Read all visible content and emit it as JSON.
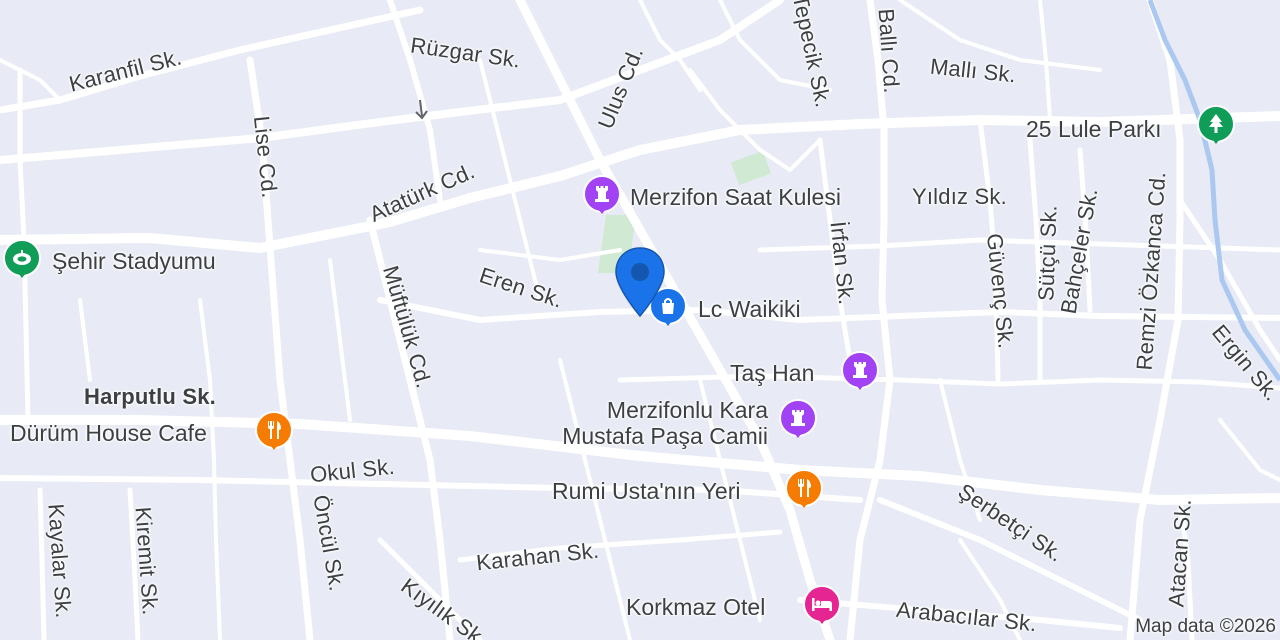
{
  "map": {
    "attribution": "Map data ©2026",
    "streets": [
      {
        "id": "karanfil",
        "label": "Karanfil Sk."
      },
      {
        "id": "ruzgar",
        "label": "Rüzgar Sk."
      },
      {
        "id": "ulus",
        "label": "Ulus Cd."
      },
      {
        "id": "tepecik",
        "label": "Tepecik Sk."
      },
      {
        "id": "bali",
        "label": "Ballı Cd."
      },
      {
        "id": "malli",
        "label": "Mallı Sk."
      },
      {
        "id": "lise",
        "label": "Lise Cd."
      },
      {
        "id": "ataturk",
        "label": "Atatürk Cd."
      },
      {
        "id": "yildiz",
        "label": "Yıldız Sk."
      },
      {
        "id": "irfan",
        "label": "İrfan Sk."
      },
      {
        "id": "guvenc",
        "label": "Güvenç Sk."
      },
      {
        "id": "sutcu",
        "label": "Sütçü Sk."
      },
      {
        "id": "bahceler",
        "label": "Bahçeler Sk."
      },
      {
        "id": "remzi",
        "label": "Remzi Özkanca Cd."
      },
      {
        "id": "ergin",
        "label": "Ergin Sk."
      },
      {
        "id": "eren",
        "label": "Eren Sk."
      },
      {
        "id": "muftuluk",
        "label": "Müftülük Cd."
      },
      {
        "id": "harputlu",
        "label": "Harputlu Sk."
      },
      {
        "id": "okul",
        "label": "Okul Sk."
      },
      {
        "id": "oncul",
        "label": "Öncül Sk."
      },
      {
        "id": "serbetci",
        "label": "Şerbetçi Sk."
      },
      {
        "id": "atacan",
        "label": "Atacan Sk."
      },
      {
        "id": "karahan",
        "label": "Karahan Sk."
      },
      {
        "id": "kiyilik",
        "label": "Kıyılık Sk."
      },
      {
        "id": "arabacilar",
        "label": "Arabacılar Sk."
      },
      {
        "id": "kayalar",
        "label": "Kayalar Sk."
      },
      {
        "id": "kiremit",
        "label": "Kiremit Sk."
      }
    ],
    "pois": [
      {
        "id": "lule-parki",
        "label": "25 Lule Parkı",
        "icon": "tree-icon",
        "color": "#0f9d58"
      },
      {
        "id": "saat-kulesi",
        "label": "Merzifon Saat Kulesi",
        "icon": "landmark-icon",
        "color": "#a142f4"
      },
      {
        "id": "stadyum",
        "label": "Şehir Stadyumu",
        "icon": "stadium-icon",
        "color": "#0f9d58"
      },
      {
        "id": "lc-waikiki",
        "label": "Lc Waikiki",
        "icon": "shopping-bag-icon",
        "color": "#1a73e8"
      },
      {
        "id": "tas-han",
        "label": "Taş Han",
        "icon": "landmark-icon",
        "color": "#a142f4"
      },
      {
        "id": "kara-mustafa",
        "label": "Merzifonlu Kara",
        "label2": "Mustafa Paşa Camii",
        "icon": "landmark-icon",
        "color": "#a142f4"
      },
      {
        "id": "durum-house",
        "label": "Dürüm House Cafe",
        "icon": "restaurant-icon",
        "color": "#f57c00"
      },
      {
        "id": "rumi-usta",
        "label": "Rumi Usta'nın Yeri",
        "icon": "restaurant-icon",
        "color": "#f57c00"
      },
      {
        "id": "korkmaz",
        "label": "Korkmaz Otel",
        "icon": "hotel-icon",
        "color": "#e52592"
      }
    ],
    "marker": {
      "label": "selected-location",
      "color": "#1a73e8"
    }
  }
}
